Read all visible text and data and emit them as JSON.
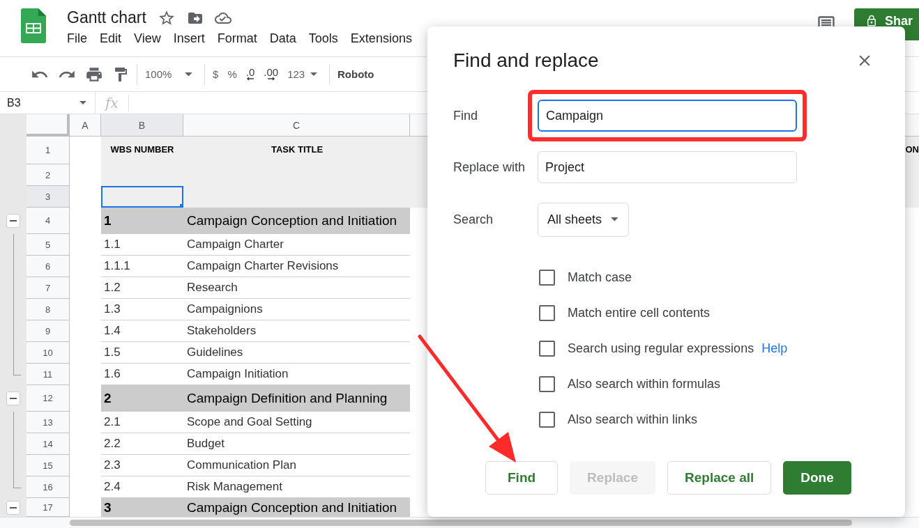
{
  "document": {
    "title": "Gantt chart"
  },
  "menu": [
    "File",
    "Edit",
    "View",
    "Insert",
    "Format",
    "Data",
    "Tools",
    "Extensions"
  ],
  "share_button": {
    "label": "Shar"
  },
  "toolbar": {
    "zoom": "100%",
    "currency": "$",
    "percent": "%",
    "decrease_decimals": ".0",
    "increase_decimals": ".00",
    "number_format": "123",
    "font": "Roboto"
  },
  "name_box": "B3",
  "formula_label": "fx",
  "columns": [
    {
      "label": "A",
      "selected": false
    },
    {
      "label": "B",
      "selected": true
    },
    {
      "label": "C",
      "selected": false
    }
  ],
  "rows": [
    {
      "number": "1",
      "kind": "header",
      "wbs": "WBS NUMBER",
      "title": "TASK TITLE",
      "column_4": "ON",
      "selected": false
    },
    {
      "number": "2",
      "kind": "header",
      "selected": false
    },
    {
      "number": "3",
      "kind": "header",
      "selected": true
    },
    {
      "number": "4",
      "kind": "section",
      "wbs": "1",
      "title": "Campaign Conception and Initiation",
      "selected": false
    },
    {
      "number": "5",
      "kind": "item",
      "wbs": "1.1",
      "title": "Campaign Charter",
      "selected": false
    },
    {
      "number": "6",
      "kind": "item",
      "wbs": "1.1.1",
      "title": "Campaign Charter Revisions",
      "selected": false
    },
    {
      "number": "7",
      "kind": "item",
      "wbs": "1.2",
      "title": "Research",
      "selected": false
    },
    {
      "number": "8",
      "kind": "item",
      "wbs": "1.3",
      "title": "Campaignions",
      "selected": false
    },
    {
      "number": "9",
      "kind": "item",
      "wbs": "1.4",
      "title": "Stakeholders",
      "selected": false
    },
    {
      "number": "10",
      "kind": "item",
      "wbs": "1.5",
      "title": "Guidelines",
      "selected": false
    },
    {
      "number": "11",
      "kind": "item",
      "wbs": "1.6",
      "title": "Campaign Initiation",
      "selected": false
    },
    {
      "number": "12",
      "kind": "section",
      "wbs": "2",
      "title": "Campaign Definition and Planning",
      "selected": false
    },
    {
      "number": "13",
      "kind": "item",
      "wbs": "2.1",
      "title": "Scope and Goal Setting",
      "selected": false
    },
    {
      "number": "14",
      "kind": "item",
      "wbs": "2.2",
      "title": "Budget",
      "selected": false
    },
    {
      "number": "15",
      "kind": "item",
      "wbs": "2.3",
      "title": "Communication Plan",
      "selected": false
    },
    {
      "number": "16",
      "kind": "item",
      "wbs": "2.4",
      "title": "Risk Management",
      "selected": false
    },
    {
      "number": "17",
      "kind": "section",
      "wbs": "3",
      "title": "Campaign Conception and Initiation",
      "selected": false
    }
  ],
  "dialog": {
    "title": "Find and replace",
    "find": {
      "label": "Find",
      "value": "Campaign",
      "focused": true,
      "highlighted": true
    },
    "replace": {
      "label": "Replace with",
      "value": "Project"
    },
    "search": {
      "label": "Search",
      "value": "All sheets"
    },
    "options": [
      {
        "label": "Match case",
        "checked": false
      },
      {
        "label": "Match entire cell contents",
        "checked": false
      },
      {
        "label": "Search using regular expressions",
        "checked": false,
        "link": "Help"
      },
      {
        "label": "Also search within formulas",
        "checked": false
      },
      {
        "label": "Also search within links",
        "checked": false
      }
    ],
    "buttons": [
      {
        "label": "Find",
        "kind": "default",
        "disabled": false
      },
      {
        "label": "Replace",
        "kind": "default",
        "disabled": true
      },
      {
        "label": "Replace all",
        "kind": "default",
        "disabled": false
      },
      {
        "label": "Done",
        "kind": "primary",
        "disabled": false
      }
    ]
  }
}
